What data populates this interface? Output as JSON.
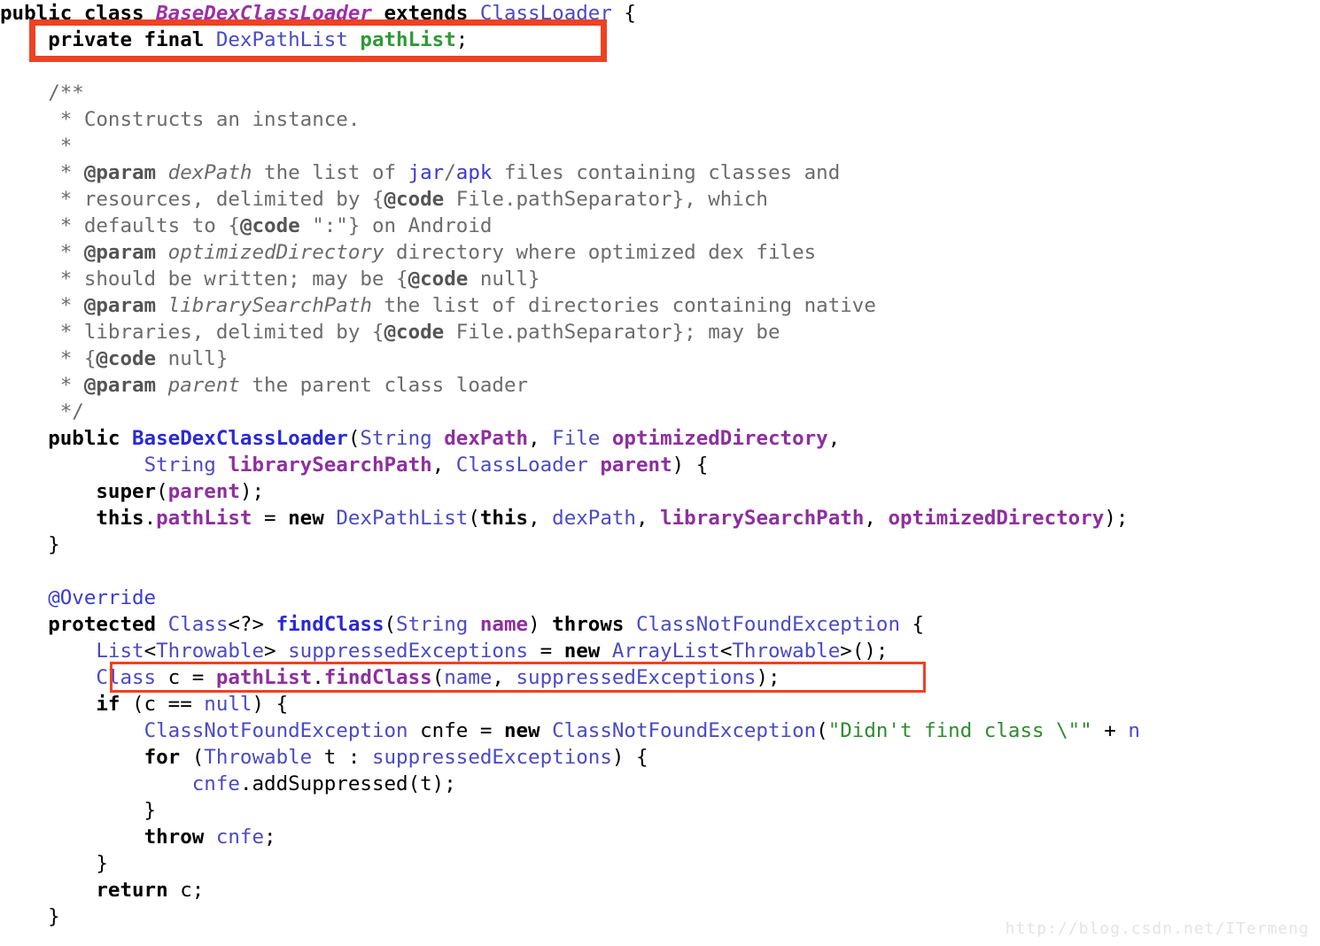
{
  "page": {
    "kind": "source-code-screenshot",
    "language": "Java",
    "background_color": "#ffffff",
    "gutter_color": "#e9e9e9",
    "highlight_color": "#ee4222"
  },
  "watermark": {
    "text": "http://blog.csdn.net/ITermeng"
  },
  "highlights": [
    {
      "name": "pathList-field-declaration",
      "line_index": 1,
      "border_px": 7
    },
    {
      "name": "pathList-findClass-call",
      "line_index": 24,
      "border_px": 3
    }
  ],
  "code": {
    "lines": [
      {
        "i": 0,
        "text": "public class BaseDexClassLoader extends ClassLoader {"
      },
      {
        "i": 1,
        "text": "    private final DexPathList pathList;"
      },
      {
        "i": 2,
        "text": ""
      },
      {
        "i": 3,
        "text": "    /**"
      },
      {
        "i": 4,
        "text": "     * Constructs an instance."
      },
      {
        "i": 5,
        "text": "     *"
      },
      {
        "i": 6,
        "text": "     * @param dexPath the list of jar/apk files containing classes and"
      },
      {
        "i": 7,
        "text": "     * resources, delimited by {@code File.pathSeparator}, which"
      },
      {
        "i": 8,
        "text": "     * defaults to {@code \":\"} on Android"
      },
      {
        "i": 9,
        "text": "     * @param optimizedDirectory directory where optimized dex files"
      },
      {
        "i": 10,
        "text": "     * should be written; may be {@code null}"
      },
      {
        "i": 11,
        "text": "     * @param librarySearchPath the list of directories containing native"
      },
      {
        "i": 12,
        "text": "     * libraries, delimited by {@code File.pathSeparator}; may be"
      },
      {
        "i": 13,
        "text": "     * {@code null}"
      },
      {
        "i": 14,
        "text": "     * @param parent the parent class loader"
      },
      {
        "i": 15,
        "text": "     */"
      },
      {
        "i": 16,
        "text": "    public BaseDexClassLoader(String dexPath, File optimizedDirectory,"
      },
      {
        "i": 17,
        "text": "            String librarySearchPath, ClassLoader parent) {"
      },
      {
        "i": 18,
        "text": "        super(parent);"
      },
      {
        "i": 19,
        "text": "        this.pathList = new DexPathList(this, dexPath, librarySearchPath, optimizedDirectory);"
      },
      {
        "i": 20,
        "text": "    }"
      },
      {
        "i": 21,
        "text": ""
      },
      {
        "i": 22,
        "text": "    @Override"
      },
      {
        "i": 23,
        "text": "    protected Class<?> findClass(String name) throws ClassNotFoundException {"
      },
      {
        "i": 24,
        "text": "        List<Throwable> suppressedExceptions = new ArrayList<Throwable>();"
      },
      {
        "i": 25,
        "text": "        Class c = pathList.findClass(name, suppressedExceptions);"
      },
      {
        "i": 26,
        "text": "        if (c == null) {"
      },
      {
        "i": 27,
        "text": "            ClassNotFoundException cnfe = new ClassNotFoundException(\"Didn't find class \\\"\" + n"
      },
      {
        "i": 28,
        "text": "            for (Throwable t : suppressedExceptions) {"
      },
      {
        "i": 29,
        "text": "                cnfe.addSuppressed(t);"
      },
      {
        "i": 30,
        "text": "            }"
      },
      {
        "i": 31,
        "text": "            throw cnfe;"
      },
      {
        "i": 32,
        "text": "        }"
      },
      {
        "i": 33,
        "text": "        return c;"
      },
      {
        "i": 34,
        "text": "    }"
      }
    ]
  },
  "tokens": {
    "l0": [
      [
        "kw",
        "public"
      ],
      [
        "pln",
        " "
      ],
      [
        "kw",
        "class"
      ],
      [
        "pln",
        " "
      ],
      [
        "cls",
        "BaseDexClassLoader"
      ],
      [
        "pln",
        " "
      ],
      [
        "kw",
        "extends"
      ],
      [
        "pln",
        " "
      ],
      [
        "typ",
        "ClassLoader"
      ],
      [
        "pln",
        " {"
      ]
    ],
    "l1": [
      [
        "pln",
        "    "
      ],
      [
        "kw",
        "private final"
      ],
      [
        "pln",
        " "
      ],
      [
        "typ",
        "DexPathList"
      ],
      [
        "pln",
        " "
      ],
      [
        "fld",
        "pathList"
      ],
      [
        "pln",
        ";"
      ]
    ],
    "l3": [
      [
        "pln",
        "    "
      ],
      [
        "cmt",
        "/**"
      ]
    ],
    "l4": [
      [
        "pln",
        "     "
      ],
      [
        "cmt",
        "* Constructs an instance."
      ]
    ],
    "l5": [
      [
        "pln",
        "     "
      ],
      [
        "cmt",
        "*"
      ]
    ],
    "l6": [
      [
        "pln",
        "     "
      ],
      [
        "cmt",
        "* "
      ],
      [
        "cmtb",
        "@param"
      ],
      [
        "cmt",
        " "
      ],
      [
        "cmti",
        "dexPath"
      ],
      [
        "cmt",
        " the list of "
      ],
      [
        "cmtl",
        "jar"
      ],
      [
        "cmt",
        "/"
      ],
      [
        "cmtl",
        "apk"
      ],
      [
        "cmt",
        " files containing classes and"
      ]
    ],
    "l7": [
      [
        "pln",
        "     "
      ],
      [
        "cmt",
        "* resources, delimited by {"
      ],
      [
        "cmtb",
        "@code"
      ],
      [
        "cmt",
        " File.pathSeparator}, which"
      ]
    ],
    "l8": [
      [
        "pln",
        "     "
      ],
      [
        "cmt",
        "* defaults to {"
      ],
      [
        "cmtb",
        "@code"
      ],
      [
        "cmt",
        " \":\"} on Android"
      ]
    ],
    "l9": [
      [
        "pln",
        "     "
      ],
      [
        "cmt",
        "* "
      ],
      [
        "cmtb",
        "@param"
      ],
      [
        "cmt",
        " "
      ],
      [
        "cmti",
        "optimizedDirectory"
      ],
      [
        "cmt",
        " directory where optimized dex files"
      ]
    ],
    "l10": [
      [
        "pln",
        "     "
      ],
      [
        "cmt",
        "* should be written; may be {"
      ],
      [
        "cmtb",
        "@code"
      ],
      [
        "cmt",
        " null}"
      ]
    ],
    "l11": [
      [
        "pln",
        "     "
      ],
      [
        "cmt",
        "* "
      ],
      [
        "cmtb",
        "@param"
      ],
      [
        "cmt",
        " "
      ],
      [
        "cmti",
        "librarySearchPath"
      ],
      [
        "cmt",
        " the list of directories containing native"
      ]
    ],
    "l12": [
      [
        "pln",
        "     "
      ],
      [
        "cmt",
        "* libraries, delimited by {"
      ],
      [
        "cmtb",
        "@code"
      ],
      [
        "cmt",
        " File.pathSeparator}; may be"
      ]
    ],
    "l13": [
      [
        "pln",
        "     "
      ],
      [
        "cmt",
        "* {"
      ],
      [
        "cmtb",
        "@code"
      ],
      [
        "cmt",
        " null}"
      ]
    ],
    "l14": [
      [
        "pln",
        "     "
      ],
      [
        "cmt",
        "* "
      ],
      [
        "cmtb",
        "@param"
      ],
      [
        "cmt",
        " "
      ],
      [
        "cmti",
        "parent"
      ],
      [
        "cmt",
        " the parent class loader"
      ]
    ],
    "l15": [
      [
        "pln",
        "     "
      ],
      [
        "cmt",
        "*/"
      ]
    ],
    "l16": [
      [
        "pln",
        "    "
      ],
      [
        "kw",
        "public"
      ],
      [
        "pln",
        " "
      ],
      [
        "mth",
        "BaseDexClassLoader"
      ],
      [
        "pln",
        "("
      ],
      [
        "typ",
        "String"
      ],
      [
        "pln",
        " "
      ],
      [
        "var",
        "dexPath"
      ],
      [
        "pln",
        ", "
      ],
      [
        "typ",
        "File"
      ],
      [
        "pln",
        " "
      ],
      [
        "var",
        "optimizedDirectory"
      ],
      [
        "pln",
        ","
      ]
    ],
    "l17": [
      [
        "pln",
        "            "
      ],
      [
        "typ",
        "String"
      ],
      [
        "pln",
        " "
      ],
      [
        "var",
        "librarySearchPath"
      ],
      [
        "pln",
        ", "
      ],
      [
        "typ",
        "ClassLoader"
      ],
      [
        "pln",
        " "
      ],
      [
        "var",
        "parent"
      ],
      [
        "pln",
        ") {"
      ]
    ],
    "l18": [
      [
        "pln",
        "        "
      ],
      [
        "kw",
        "super"
      ],
      [
        "pln",
        "("
      ],
      [
        "var",
        "parent"
      ],
      [
        "pln",
        ");"
      ]
    ],
    "l19": [
      [
        "pln",
        "        "
      ],
      [
        "kw",
        "this"
      ],
      [
        "pln",
        "."
      ],
      [
        "var",
        "pathList"
      ],
      [
        "pln",
        " = "
      ],
      [
        "kw",
        "new"
      ],
      [
        "pln",
        " "
      ],
      [
        "typ",
        "DexPathList"
      ],
      [
        "pln",
        "("
      ],
      [
        "kw",
        "this"
      ],
      [
        "pln",
        ", "
      ],
      [
        "typ",
        "dexPath"
      ],
      [
        "pln",
        ", "
      ],
      [
        "var",
        "librarySearchPath"
      ],
      [
        "pln",
        ", "
      ],
      [
        "var",
        "optimizedDirectory"
      ],
      [
        "pln",
        ");"
      ]
    ],
    "l20": [
      [
        "pln",
        "    }"
      ]
    ],
    "l22": [
      [
        "pln",
        "    "
      ],
      [
        "ann",
        "@Override"
      ]
    ],
    "l23": [
      [
        "pln",
        "    "
      ],
      [
        "kw",
        "protected"
      ],
      [
        "pln",
        " "
      ],
      [
        "typ",
        "Class"
      ],
      [
        "pln",
        "<?> "
      ],
      [
        "mth",
        "findClass"
      ],
      [
        "pln",
        "("
      ],
      [
        "typ",
        "String"
      ],
      [
        "pln",
        " "
      ],
      [
        "var",
        "name"
      ],
      [
        "pln",
        ") "
      ],
      [
        "kw",
        "throws"
      ],
      [
        "pln",
        " "
      ],
      [
        "typ",
        "ClassNotFoundException"
      ],
      [
        "pln",
        " {"
      ]
    ],
    "l24": [
      [
        "pln",
        "        "
      ],
      [
        "typ",
        "List"
      ],
      [
        "pln",
        "<"
      ],
      [
        "typ",
        "Throwable"
      ],
      [
        "pln",
        "> "
      ],
      [
        "typ",
        "suppressedExceptions"
      ],
      [
        "pln",
        " = "
      ],
      [
        "kw",
        "new"
      ],
      [
        "pln",
        " "
      ],
      [
        "typ",
        "ArrayList"
      ],
      [
        "pln",
        "<"
      ],
      [
        "typ",
        "Throwable"
      ],
      [
        "pln",
        ">();"
      ]
    ],
    "l25": [
      [
        "pln",
        "        "
      ],
      [
        "typ",
        "Class"
      ],
      [
        "pln",
        " c = "
      ],
      [
        "pmth",
        "pathList"
      ],
      [
        "pln",
        "."
      ],
      [
        "pmth",
        "findClass"
      ],
      [
        "pln",
        "("
      ],
      [
        "typ",
        "name"
      ],
      [
        "pln",
        ", "
      ],
      [
        "typ",
        "suppressedExceptions"
      ],
      [
        "pln",
        ");"
      ]
    ],
    "l26": [
      [
        "pln",
        "        "
      ],
      [
        "kw",
        "if"
      ],
      [
        "pln",
        " (c == "
      ],
      [
        "typ",
        "null"
      ],
      [
        "pln",
        ") {"
      ]
    ],
    "l27": [
      [
        "pln",
        "            "
      ],
      [
        "typ",
        "ClassNotFoundException"
      ],
      [
        "pln",
        " cnfe = "
      ],
      [
        "kw",
        "new"
      ],
      [
        "pln",
        " "
      ],
      [
        "typ",
        "ClassNotFoundException"
      ],
      [
        "pln",
        "("
      ],
      [
        "str",
        "\"Didn't find class \\\"\""
      ],
      [
        "pln",
        " + "
      ],
      [
        "typ",
        "n"
      ]
    ],
    "l28": [
      [
        "pln",
        "            "
      ],
      [
        "kw",
        "for"
      ],
      [
        "pln",
        " ("
      ],
      [
        "typ",
        "Throwable"
      ],
      [
        "pln",
        " t : "
      ],
      [
        "typ",
        "suppressedExceptions"
      ],
      [
        "pln",
        ") {"
      ]
    ],
    "l29": [
      [
        "pln",
        "                "
      ],
      [
        "typ",
        "cnfe"
      ],
      [
        "pln",
        ".addSuppressed(t);"
      ]
    ],
    "l30": [
      [
        "pln",
        "            }"
      ]
    ],
    "l31": [
      [
        "pln",
        "            "
      ],
      [
        "kw",
        "throw"
      ],
      [
        "pln",
        " "
      ],
      [
        "typ",
        "cnfe"
      ],
      [
        "pln",
        ";"
      ]
    ],
    "l32": [
      [
        "pln",
        "        }"
      ]
    ],
    "l33": [
      [
        "pln",
        "        "
      ],
      [
        "kw",
        "return"
      ],
      [
        "pln",
        " c;"
      ]
    ],
    "l34": [
      [
        "pln",
        "    }"
      ]
    ]
  }
}
